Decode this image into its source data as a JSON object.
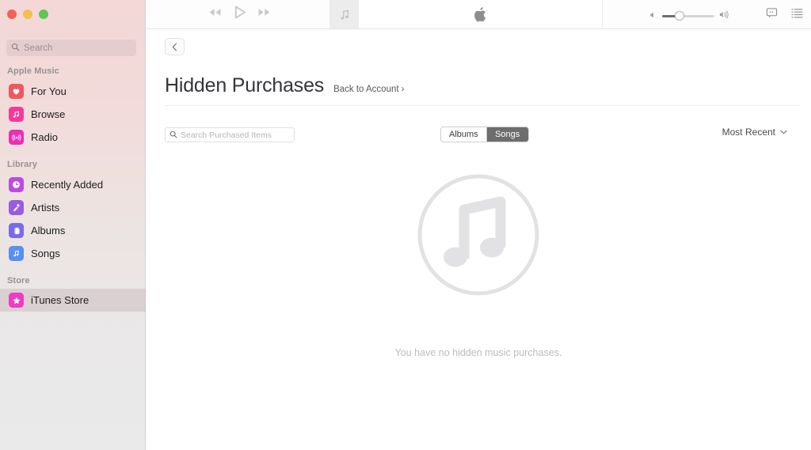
{
  "window": {
    "traffic_lights": [
      {
        "name": "close",
        "color": "#f2615a"
      },
      {
        "name": "minimize",
        "color": "#f5bf4f"
      },
      {
        "name": "zoom",
        "color": "#61c554"
      }
    ]
  },
  "sidebar": {
    "search": {
      "placeholder": "Search",
      "value": "",
      "icon": "search-icon"
    },
    "sections": [
      {
        "heading": "Apple Music",
        "items": [
          {
            "label": "For You",
            "icon": "heart-icon",
            "color": "#f0585f",
            "selected": false
          },
          {
            "label": "Browse",
            "icon": "music-note-icon",
            "color": "#f4399b",
            "selected": false
          },
          {
            "label": "Radio",
            "icon": "radio-waves-icon",
            "color": "#e92fb6",
            "selected": false
          }
        ]
      },
      {
        "heading": "Library",
        "items": [
          {
            "label": "Recently Added",
            "icon": "clock-icon",
            "color": "#bd4ae0",
            "selected": false
          },
          {
            "label": "Artists",
            "icon": "microphone-icon",
            "color": "#9a5be0",
            "selected": false
          },
          {
            "label": "Albums",
            "icon": "albums-stack-icon",
            "color": "#7b6ae8",
            "selected": false
          },
          {
            "label": "Songs",
            "icon": "music-note-icon",
            "color": "#5b8ff0",
            "selected": false
          }
        ]
      },
      {
        "heading": "Store",
        "items": [
          {
            "label": "iTunes Store",
            "icon": "star-icon",
            "color": "#ee3cc8",
            "selected": true
          }
        ]
      }
    ]
  },
  "toolbar": {
    "transport": [
      {
        "name": "rewind-button",
        "icon": "rewind-icon"
      },
      {
        "name": "play-button",
        "icon": "play-icon"
      },
      {
        "name": "fast-forward-button",
        "icon": "fast-forward-icon"
      }
    ],
    "now_playing": {
      "artwork_icon": "music-note-icon",
      "center_icon": "apple-logo-icon",
      "title": "",
      "subtitle": ""
    },
    "volume": {
      "min_icon": "speaker-low-icon",
      "max_icon": "speaker-high-icon",
      "level": 33
    },
    "right_icons": [
      {
        "name": "lyrics-button",
        "icon": "speech-bubble-icon"
      },
      {
        "name": "queue-button",
        "icon": "list-icon"
      }
    ]
  },
  "content": {
    "back_button": {
      "icon": "chevron-left-icon"
    },
    "title": "Hidden Purchases",
    "back_link": {
      "label": "Back to Account",
      "chevron": "›"
    },
    "search": {
      "placeholder": "Search Purchased Items",
      "value": "",
      "icon": "search-icon"
    },
    "segmented": {
      "options": [
        {
          "label": "Albums",
          "selected": false
        },
        {
          "label": "Songs",
          "selected": true
        }
      ]
    },
    "sort": {
      "label": "Most Recent",
      "icon": "chevron-down-icon"
    },
    "empty_state": {
      "icon": "music-note-circle-icon",
      "message": "You have no hidden music purchases."
    }
  }
}
